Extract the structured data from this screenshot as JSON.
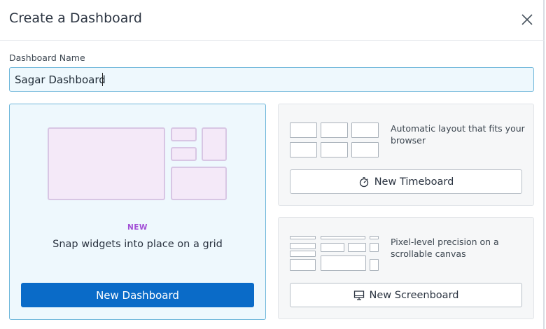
{
  "dialog": {
    "title": "Create a Dashboard",
    "close_icon": "close-icon"
  },
  "name_field": {
    "label": "Dashboard Name",
    "value": "Sagar Dashboard"
  },
  "dashboard_card": {
    "badge": "NEW",
    "description": "Snap widgets into place on a grid",
    "button_label": "New Dashboard"
  },
  "timeboard_card": {
    "description": "Automatic layout that fits your browser",
    "button_label": "New Timeboard",
    "button_icon": "stopwatch-icon"
  },
  "screenboard_card": {
    "description": "Pixel-level precision on a scrollable canvas",
    "button_label": "New Screenboard",
    "button_icon": "monitor-icon"
  },
  "colors": {
    "primary": "#0a6bc8",
    "badge": "#a24fd6",
    "selected_border": "#6fb7da",
    "selected_bg": "#eef8fd"
  }
}
